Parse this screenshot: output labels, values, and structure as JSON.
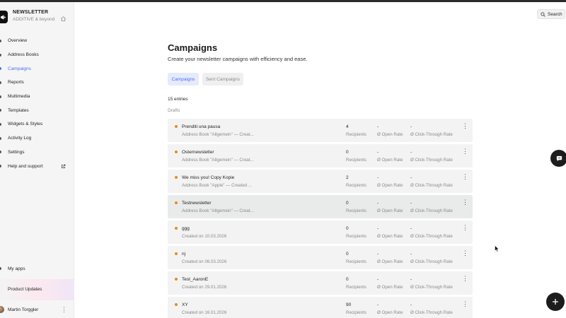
{
  "app": {
    "title": "NEWSLETTER",
    "subtitle": "ADDITIVE & beyond",
    "logo_icon": "megaphone-icon",
    "home_icon": "home-icon"
  },
  "sidebar": {
    "items": [
      {
        "label": "Overview",
        "active": false
      },
      {
        "label": "Address Books",
        "active": false
      },
      {
        "label": "Campaigns",
        "active": true
      },
      {
        "label": "Reports",
        "active": false
      },
      {
        "label": "Multimedia",
        "active": false
      },
      {
        "label": "Templates",
        "active": false
      },
      {
        "label": "Widgets & Styles",
        "active": false
      },
      {
        "label": "Activity Log",
        "active": false
      },
      {
        "label": "Settings",
        "active": false
      },
      {
        "label": "Help and support",
        "active": false,
        "icon": "external-link-icon"
      }
    ],
    "my_apps": "My apps",
    "product_updates": "Product Updates",
    "user": {
      "name": "Martin Torggler",
      "menu_icon": "kebab-icon"
    }
  },
  "header": {
    "search_label": "Search",
    "search_icon": "search-icon"
  },
  "main": {
    "title": "Campaigns",
    "subtitle": "Create your newsletter campaigns with efficiency and ease.",
    "tabs": [
      {
        "label": "Campaigns",
        "active": true
      },
      {
        "label": "Sent Campaigns",
        "active": false
      }
    ],
    "entries_count": "15 entries",
    "section_label": "Drafts",
    "columns": {
      "recipients_label": "Recipients",
      "open_rate_label": "Ø Open Rate",
      "ctr_label": "Ø Click-Through Rate"
    },
    "campaigns": [
      {
        "name": "Prenditi una pausa",
        "meta": "Address Book \"Allgemein\" — Creat...",
        "recipients": "4",
        "open_rate": "-",
        "ctr": "-"
      },
      {
        "name": "Osternewsletter",
        "meta": "Address Book \"Allgemein\" — Creat...",
        "recipients": "0",
        "open_rate": "-",
        "ctr": "-"
      },
      {
        "name": "We miss you! Copy Kopie",
        "meta": "Address Book \"Apple\" — Created ...",
        "recipients": "2",
        "open_rate": "-",
        "ctr": "-"
      },
      {
        "name": "Testnewsletter",
        "meta": "Address Book \"Allgemein\" — Creat...",
        "recipients": "0",
        "open_rate": "-",
        "ctr": "-"
      },
      {
        "name": "ggg",
        "meta": "Created on 10.03.2026",
        "recipients": "0",
        "open_rate": "-",
        "ctr": "-"
      },
      {
        "name": "nj",
        "meta": "Created on 06.03.2026",
        "recipients": "0",
        "open_rate": "-",
        "ctr": "-"
      },
      {
        "name": "Test_AaronE",
        "meta": "Created on 29.01.2026",
        "recipients": "0",
        "open_rate": "-",
        "ctr": "-"
      },
      {
        "name": "XY",
        "meta": "Created on 16.01.2026",
        "recipients": "90",
        "open_rate": "-",
        "ctr": "-"
      }
    ]
  },
  "colors": {
    "accent": "#4a6df0",
    "draft_status": "#e58a1f",
    "fab": "#1c1c1c"
  },
  "floating": {
    "chat_icon": "chat-bubble-icon",
    "add_icon": "plus-icon"
  }
}
